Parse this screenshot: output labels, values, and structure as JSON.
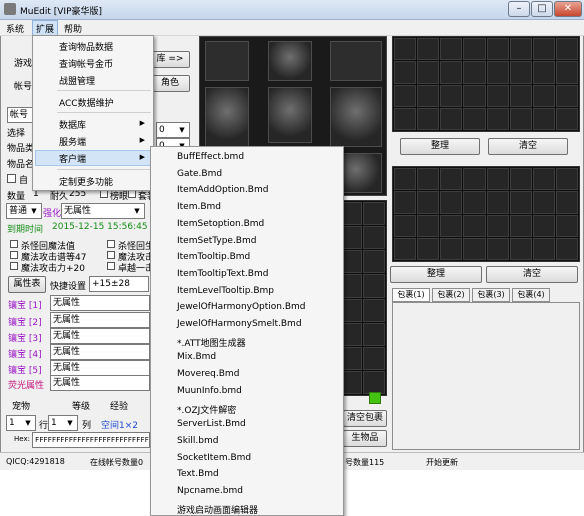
{
  "window": {
    "title": "MuEdit [VIP豪华版]"
  },
  "menubar": [
    "系统",
    "扩展",
    "帮助"
  ],
  "ext_menu": {
    "items": [
      "查询物品数据",
      "查询帐号金币",
      "战盟管理",
      "ACC数据维护",
      "数据库",
      "服务端",
      "客户端",
      "定制更多功能"
    ]
  },
  "client_menu": {
    "items": [
      "BuffEffect.bmd",
      "Gate.Bmd",
      "ItemAddOption.Bmd",
      "Item.Bmd",
      "ItemSetoption.Bmd",
      "ItemSetType.Bmd",
      "ItemTooltip.Bmd",
      "ItemTooltipText.Bmd",
      "ItemLevelTooltip.Bmp",
      "JewelOfHarmonyOption.Bmd",
      "JewelOfHarmonySmelt.Bmd",
      "*.ATT地图生成器",
      "Mix.Bmd",
      "Movereq.Bmd",
      "MuunInfo.bmd",
      "*.OZJ文件解密",
      "ServerList.Bmd",
      "Skill.bmd",
      "SocketItem.Bmd",
      "Text.Bmd",
      "Npcname.bmd",
      "游戏启动画面编辑器"
    ]
  },
  "left": {
    "game_label": "游戏",
    "acct_label": "帐号",
    "acct_tab": "帐号",
    "select_label": "选择",
    "itemtype_label": "物品类",
    "itemname_label": "物品名",
    "auto_label": "自",
    "qty_label": "数量",
    "qty_value": "1",
    "dur_label": "耐久",
    "dur_value": "255",
    "fix_label": "榜眼",
    "lvl_label": "套装",
    "combo_normal": "普通",
    "strengthen_label": "强化",
    "strengthen_value": "无属性",
    "expire_label": "到期时间",
    "expire_value": "2015-12-15 15:56:45",
    "opt1": "杀怪回魔法值",
    "opt2": "魔法攻击谱等47",
    "opt3": "魔法攻击力+20",
    "opt4": "杀怪回生",
    "opt5": "魔法攻击",
    "opt6": "卓越一击",
    "attr_btn": "属性表",
    "quickset_label": "快捷设置",
    "quickset_value": "+15±28",
    "gems": [
      {
        "label": "镶宝 [1]",
        "value": "无属性"
      },
      {
        "label": "镶宝 [2]",
        "value": "无属性"
      },
      {
        "label": "镶宝 [3]",
        "value": "无属性"
      },
      {
        "label": "镶宝 [4]",
        "value": "无属性"
      },
      {
        "label": "镶宝 [5]",
        "value": "无属性"
      },
      {
        "label": "荧光属性",
        "value": "无属性"
      }
    ],
    "pet_label": "宠物",
    "level_label": "等级",
    "exp_label": "经验",
    "row_value": "1",
    "row_label": "行",
    "col_value": "1",
    "col_label": "列",
    "space_label": "空间1×2",
    "hex_label": "Hex:",
    "hex_value": "FFFFFFFFFFFFFFFFFFFFFFFFFFFFFFFF"
  },
  "top_buttons": {
    "lib_btn": "库 =>",
    "role_btn": "角色",
    "zero1": "0",
    "zero2": "0"
  },
  "right": {
    "sort1": "整理",
    "clear1": "清空",
    "sort2": "整理",
    "clear2": "清空",
    "tabs": [
      "包裹(1)",
      "包裹(2)",
      "包裹(3)",
      "包裹(4)"
    ],
    "empty_btn": "清空包裹",
    "gen_btn": "生物品"
  },
  "status": {
    "qq": "QICQ:4291818",
    "online": "在线帐号数量0",
    "count": "号数量115",
    "update": "开始更新"
  },
  "colors": {
    "accent_green": "#44c411",
    "gem_purple": "#9b17c7",
    "date_green": "#168d16"
  }
}
